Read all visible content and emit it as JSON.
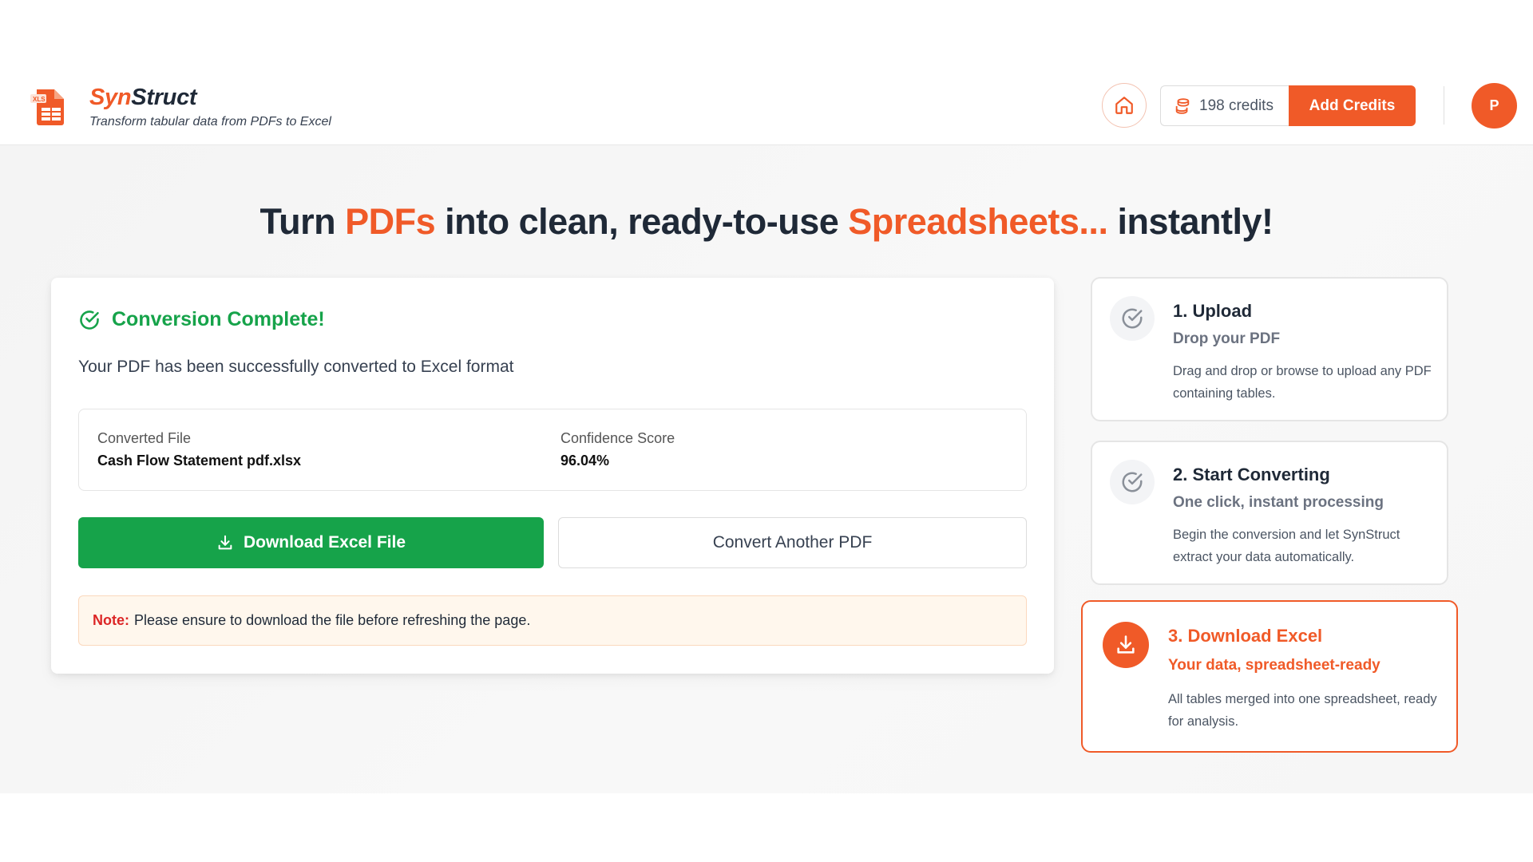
{
  "header": {
    "brand_part1": "Syn",
    "brand_part2": "Struct",
    "tagline": "Transform tabular data from PDFs to Excel",
    "logo_icon": "excel-file-icon",
    "home_icon": "home-icon",
    "credits_icon": "coins-icon",
    "credits_text": "198 credits",
    "add_credits_label": "Add Credits",
    "avatar_initial": "P"
  },
  "headline": {
    "part1": "Turn ",
    "accent1": "PDFs",
    "part2": " into clean, ready-to-use ",
    "accent2": "Spreadsheets...",
    "part3": " instantly!"
  },
  "result": {
    "title": "Conversion Complete!",
    "message": "Your PDF has been successfully converted to Excel format",
    "file_label": "Converted File",
    "file_value": "Cash Flow Statement pdf.xlsx",
    "confidence_label": "Confidence Score",
    "confidence_value": "96.04%",
    "download_label": "Download Excel File",
    "convert_label": "Convert Another PDF",
    "note_label": "Note:",
    "note_text": "Please ensure to download the file before refreshing the page."
  },
  "steps": [
    {
      "title": "1. Upload",
      "subtitle": "Drop your PDF",
      "description": "Drag and drop or browse to upload any PDF containing tables.",
      "icon": "check-circle-icon"
    },
    {
      "title": "2. Start Converting",
      "subtitle": "One click, instant processing",
      "description": "Begin the conversion and let SynStruct extract your data automatically.",
      "icon": "check-circle-icon"
    },
    {
      "title": "3. Download Excel",
      "subtitle": "Your data, spreadsheet-ready",
      "description": "All tables merged into one spreadsheet, ready for analysis.",
      "icon": "download-icon",
      "active": true
    }
  ],
  "colors": {
    "brand": "#f05a28",
    "success": "#16a34a",
    "note_bg": "#fff7ed"
  }
}
